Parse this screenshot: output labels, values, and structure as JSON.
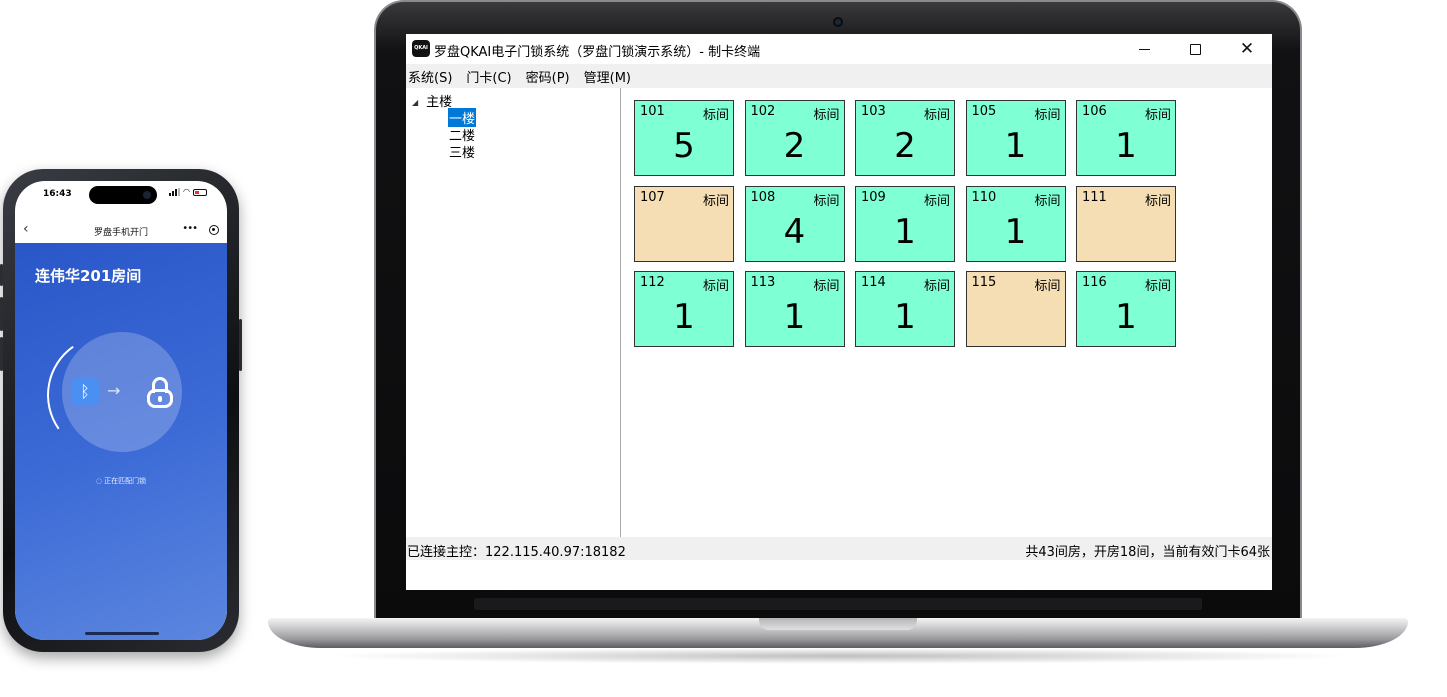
{
  "phone": {
    "status_time": "16:43",
    "nav_title": "罗盘手机开门",
    "nav_back_icon": "chevron-left-icon",
    "nav_more": "•••",
    "room_title": "连伟华201房间",
    "bluetooth_symbol": "ᛒ",
    "arrow_symbol": "→",
    "matching_status": "正在匹配门锁",
    "colors": {
      "gradient_start": "#2a57c8",
      "gradient_end": "#5c86df",
      "bluetooth": "#4b8ff0"
    }
  },
  "window": {
    "icon_text": "QKAI",
    "title": "罗盘QKAI电子门锁系统（罗盘门锁演示系统）- 制卡终端",
    "menu": [
      {
        "label": "系统(S)"
      },
      {
        "label": "门卡(C)"
      },
      {
        "label": "密码(P)"
      },
      {
        "label": "管理(M)"
      }
    ],
    "tree": {
      "root": "主楼",
      "children": [
        "一楼",
        "二楼",
        "三楼"
      ],
      "selected": "一楼"
    },
    "rooms": [
      {
        "number": "101",
        "type": "标间",
        "count": "5",
        "state": "occupied"
      },
      {
        "number": "102",
        "type": "标间",
        "count": "2",
        "state": "occupied"
      },
      {
        "number": "103",
        "type": "标间",
        "count": "2",
        "state": "occupied"
      },
      {
        "number": "105",
        "type": "标间",
        "count": "1",
        "state": "occupied"
      },
      {
        "number": "106",
        "type": "标间",
        "count": "1",
        "state": "occupied"
      },
      {
        "number": "107",
        "type": "标间",
        "count": "",
        "state": "vacant"
      },
      {
        "number": "108",
        "type": "标间",
        "count": "4",
        "state": "occupied"
      },
      {
        "number": "109",
        "type": "标间",
        "count": "1",
        "state": "occupied"
      },
      {
        "number": "110",
        "type": "标间",
        "count": "1",
        "state": "occupied"
      },
      {
        "number": "111",
        "type": "标间",
        "count": "",
        "state": "vacant"
      },
      {
        "number": "112",
        "type": "标间",
        "count": "1",
        "state": "occupied"
      },
      {
        "number": "113",
        "type": "标间",
        "count": "1",
        "state": "occupied"
      },
      {
        "number": "114",
        "type": "标间",
        "count": "1",
        "state": "occupied"
      },
      {
        "number": "115",
        "type": "标间",
        "count": "",
        "state": "vacant"
      },
      {
        "number": "116",
        "type": "标间",
        "count": "1",
        "state": "occupied"
      }
    ],
    "status_left": "已连接主控：122.115.40.97:18182",
    "status_right": "共43间房，开房18间，当前有效门卡64张",
    "colors": {
      "occupied": "#7fffd4",
      "vacant": "#f5deb3",
      "selected": "#0078d7"
    }
  }
}
